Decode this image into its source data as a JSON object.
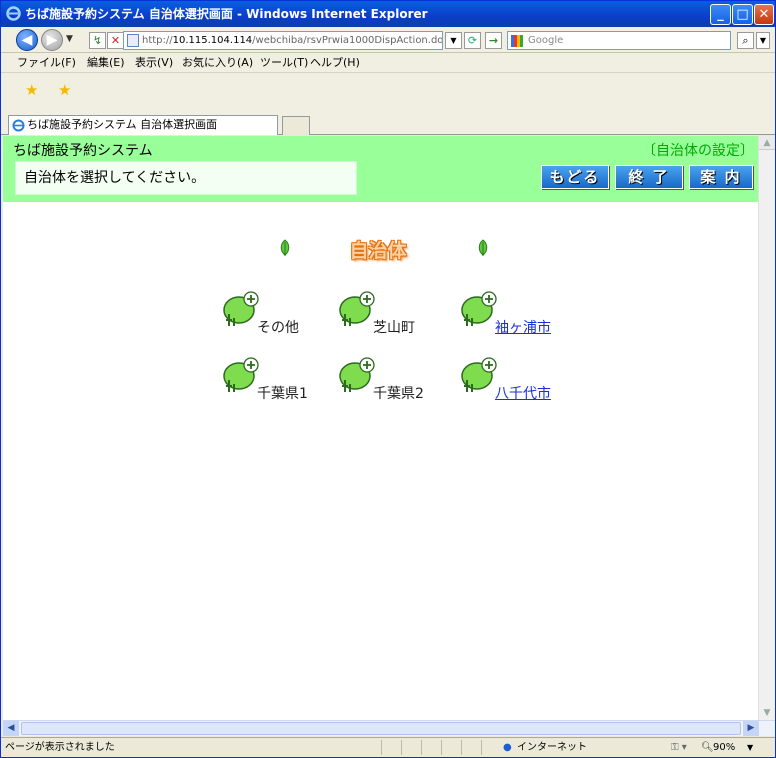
{
  "window": {
    "title": "ちば施設予約システム 自治体選択画面 - Windows Internet Explorer"
  },
  "address": {
    "url_prefix": "http://",
    "url_host": "10.115.104.114",
    "url_path": "/webchiba/rsvPrwia1000DispAction.do",
    "search_placeholder": "Google"
  },
  "menu": [
    "ファイル(F)",
    "編集(E)",
    "表示(V)",
    "お気に入り(A)",
    "ツール(T)",
    "ヘルプ(H)"
  ],
  "tab": {
    "label": "ちば施設予約システム 自治体選択画面"
  },
  "page": {
    "system_title": "ちば施設予約システム",
    "setting_label": "〔自治体の設定〕",
    "message": "自治体を選択してください。",
    "buttons": {
      "back": "もどる",
      "exit": "終 了",
      "guide": "案 内"
    },
    "heading": "自治体",
    "municipalities": [
      {
        "name": "その他",
        "link": false
      },
      {
        "name": "芝山町",
        "link": false
      },
      {
        "name": "袖ヶ浦市",
        "link": true
      },
      {
        "name": "千葉県1",
        "link": false
      },
      {
        "name": "千葉県2",
        "link": false
      },
      {
        "name": "八千代市",
        "link": true
      }
    ]
  },
  "status": {
    "text": "ページが表示されました",
    "zone": "インターネット",
    "zoom": "90%"
  },
  "colors": {
    "header_bg": "#99ff99",
    "button_blue": "#2a7fe0",
    "link": "#1a2fd8",
    "heading_orange": "#f39040"
  }
}
